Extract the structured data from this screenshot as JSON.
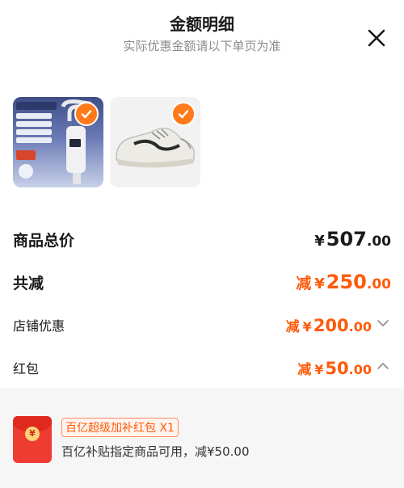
{
  "header": {
    "title": "金额明细",
    "subtitle": "实际优惠金额请以下单页为准"
  },
  "products": [
    {
      "image": "faucet-water-heater-product",
      "selected": true
    },
    {
      "image": "mizuno-sneaker-product",
      "selected": true
    }
  ],
  "summary": {
    "total_label": "商品总价",
    "total_yen": "¥",
    "total_int": "507",
    "total_dec": ".00",
    "reduce_label": "共减",
    "reduce_prefix": "减",
    "reduce_yen": "¥",
    "reduce_int": "250",
    "reduce_dec": ".00",
    "shop_label": "店铺优惠",
    "shop_prefix": "减",
    "shop_yen": "¥",
    "shop_int": "200",
    "shop_dec": ".00",
    "hongbao_label": "红包",
    "hongbao_prefix": "减",
    "hongbao_yen": "¥",
    "hongbao_int": "50",
    "hongbao_dec": ".00"
  },
  "hongbao_detail": {
    "icon_glyph": "¥",
    "tag": "百亿超级加补红包 X1",
    "description": "百亿补贴指定商品可用，减¥50.00"
  },
  "colors": {
    "accent": "#ff5a0a",
    "check": "#ff7a1a",
    "panel_bg": "#f6f6f6"
  }
}
